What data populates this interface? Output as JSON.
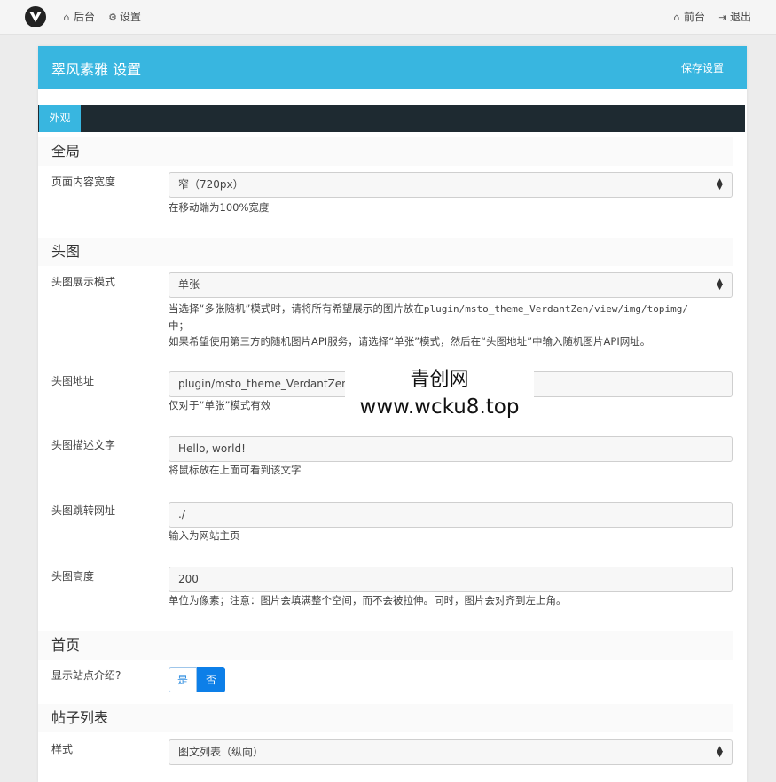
{
  "topbar": {
    "backend_label": "后台",
    "settings_label": "设置",
    "frontend_label": "前台",
    "logout_label": "退出"
  },
  "card": {
    "title": "翠风素雅 设置",
    "save_label": "保存设置",
    "active_tab": "外观"
  },
  "sections": {
    "global": {
      "title": "全局",
      "width_label": "页面内容宽度",
      "width_value": "窄（720px）",
      "width_help": "在移动端为100%宽度"
    },
    "header_image": {
      "title": "头图",
      "mode_label": "头图展示模式",
      "mode_value": "单张",
      "mode_help_1": "当选择“多张随机”模式时，请将所有希望展示的图片放在",
      "mode_help_path": "plugin/msto_theme_VerdantZen/view/img/topimg/",
      "mode_help_2": "中；",
      "mode_help_3": "如果希望使用第三方的随机图片API服务，请选择“单张”模式，然后在“头图地址”中输入随机图片API网址。",
      "url_label": "头图地址",
      "url_value": "plugin/msto_theme_VerdantZen/vi",
      "url_help": "仅对于“单张”模式有效",
      "alt_label": "头图描述文字",
      "alt_value": "Hello, world!",
      "alt_help": "将鼠标放在上面可看到该文字",
      "link_label": "头图跳转网址",
      "link_value": "./",
      "link_help": "输入为网站主页",
      "height_label": "头图高度",
      "height_value": "200",
      "height_help": "单位为像素；注意：图片会填满整个空间，而不会被拉伸。同时，图片会对齐到左上角。"
    },
    "home": {
      "title": "首页",
      "intro_label": "显示站点介绍?",
      "intro_yes": "是",
      "intro_no": "否",
      "intro_selected": "否"
    },
    "post_list": {
      "title": "帖子列表",
      "style_label": "样式",
      "style_value": "图文列表（纵向）"
    }
  },
  "watermark": {
    "line1": "青创网",
    "line2": "www.wcku8.top"
  },
  "colors": {
    "header": "#38b6e0",
    "tabbar": "#1e2a31",
    "toggle_active": "#0d7fe8"
  }
}
